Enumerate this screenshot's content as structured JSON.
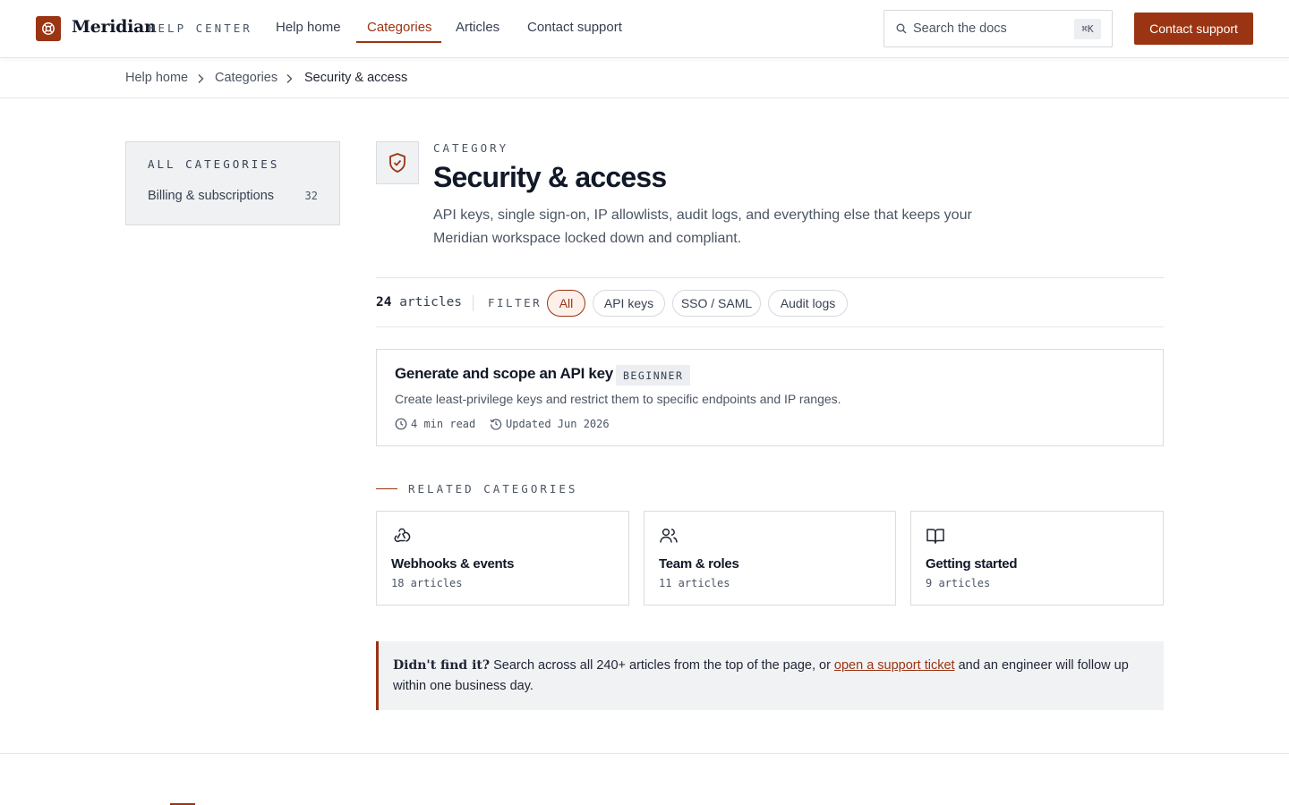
{
  "header": {
    "brand": "Meridian",
    "brand_sub": "HELP CENTER",
    "nav": [
      "Help home",
      "Categories",
      "Articles",
      "Contact support"
    ],
    "active_nav": "Categories",
    "search_placeholder": "Search the docs",
    "search_shortcut": "⌘K",
    "cta_label": "Contact support",
    "accent_color": "#9a3412"
  },
  "breadcrumb": [
    "Help home",
    "Categories",
    "Security & access"
  ],
  "sidebar": {
    "heading": "ALL CATEGORIES",
    "items": [
      {
        "label": "Billing & subscriptions",
        "count": "32"
      }
    ]
  },
  "category": {
    "eyebrow": "CATEGORY",
    "title": "Security & access",
    "description": "API keys, single sign-on, IP allowlists, audit logs, and everything else that keeps your Meridian workspace locked down and compliant.",
    "icon": "shield-check-icon"
  },
  "filter": {
    "count": "24",
    "count_suffix": "articles",
    "label": "FILTER",
    "chips": [
      "All",
      "API keys",
      "SSO / SAML",
      "Audit logs"
    ],
    "active_chip": "All"
  },
  "articles": [
    {
      "title": "Generate and scope an API key",
      "level": "BEGINNER",
      "description": "Create least-privilege keys and restrict them to specific endpoints and IP ranges.",
      "read_time": "4 min read",
      "updated": "Updated Jun 2026"
    }
  ],
  "related": {
    "heading": "RELATED CATEGORIES",
    "items": [
      {
        "title": "Webhooks & events",
        "count": "18 articles",
        "icon": "webhook-icon"
      },
      {
        "title": "Team & roles",
        "count": "11 articles",
        "icon": "users-icon"
      },
      {
        "title": "Getting started",
        "count": "9 articles",
        "icon": "book-open-icon"
      }
    ]
  },
  "callout": {
    "strong": "Didn't find it?",
    "text_before": " Search across all 240+ articles from the top of the page, or ",
    "link": "open a support ticket",
    "text_after": " and an engineer will follow up within one business day."
  }
}
